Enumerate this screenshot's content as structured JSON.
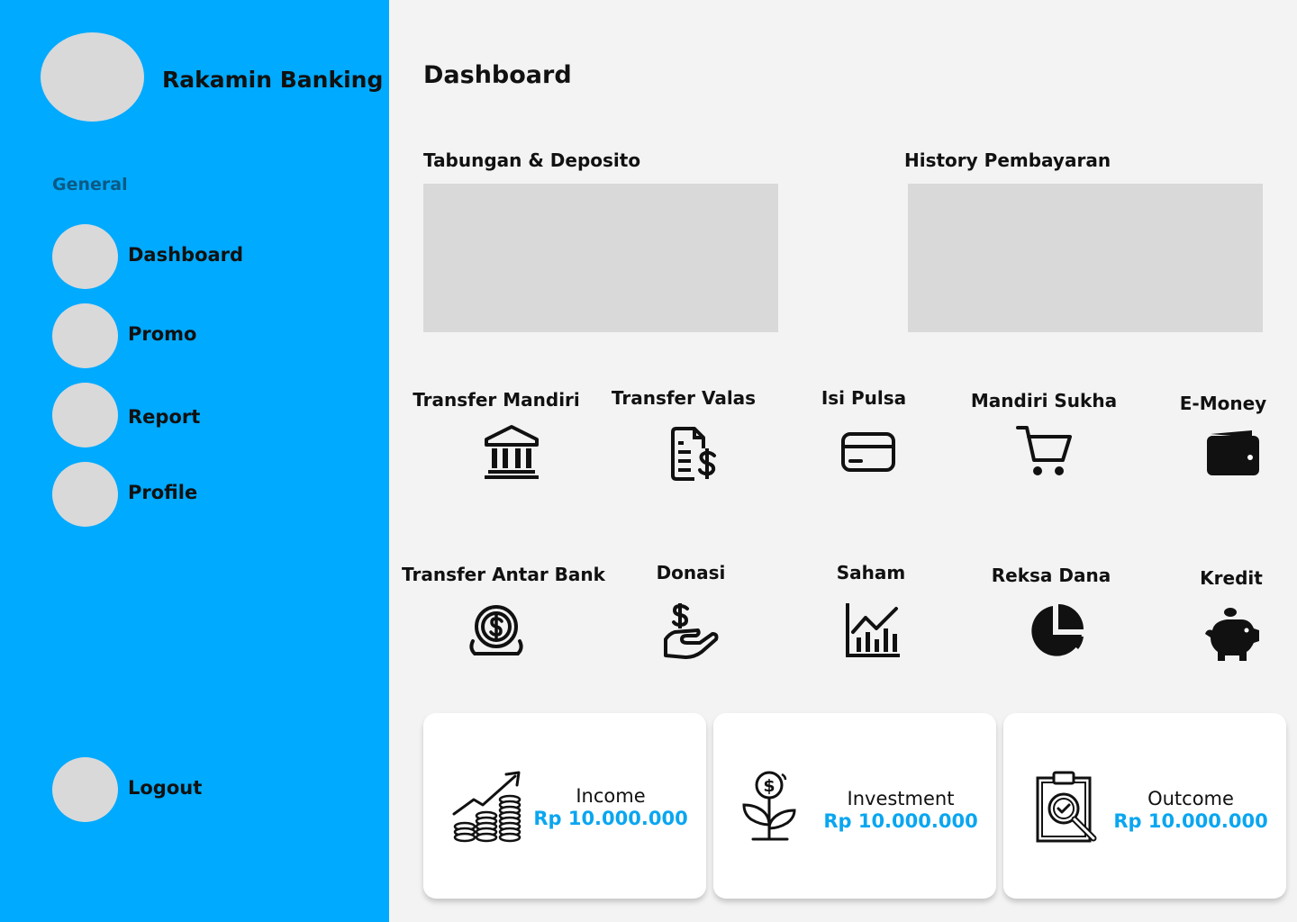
{
  "brand": {
    "name": "Rakamin Banking"
  },
  "sidebar": {
    "section_label": "General",
    "items": [
      {
        "label": "Dashboard"
      },
      {
        "label": "Promo"
      },
      {
        "label": "Report"
      },
      {
        "label": "Profile"
      }
    ],
    "logout_label": "Logout",
    "background_color": "#00aaff"
  },
  "main": {
    "title": "Dashboard",
    "cards": [
      {
        "title": "Tabungan & Deposito"
      },
      {
        "title": "History Pembayaran"
      }
    ],
    "menu": [
      {
        "label": "Transfer Mandiri",
        "icon": "bank-icon"
      },
      {
        "label": "Transfer Valas",
        "icon": "invoice-dollar-icon"
      },
      {
        "label": "Isi Pulsa",
        "icon": "credit-card-icon"
      },
      {
        "label": "Mandiri Sukha",
        "icon": "shopping-cart-icon"
      },
      {
        "label": "E-Money",
        "icon": "wallet-icon"
      },
      {
        "label": "Transfer Antar Bank",
        "icon": "coin-dollar-icon"
      },
      {
        "label": "Donasi",
        "icon": "hand-dollar-icon"
      },
      {
        "label": "Saham",
        "icon": "stock-chart-icon"
      },
      {
        "label": "Reksa Dana",
        "icon": "pie-chart-icon"
      },
      {
        "label": "Kredit",
        "icon": "piggy-bank-icon"
      }
    ],
    "stats": [
      {
        "label": "Income",
        "value": "Rp 10.000.000",
        "icon": "coins-growth-icon"
      },
      {
        "label": "Investment",
        "value": "Rp 10.000.000",
        "icon": "plant-money-icon"
      },
      {
        "label": "Outcome",
        "value": "Rp 10.000.000",
        "icon": "clipboard-search-icon"
      }
    ],
    "accent_color": "#0aa6f0"
  }
}
